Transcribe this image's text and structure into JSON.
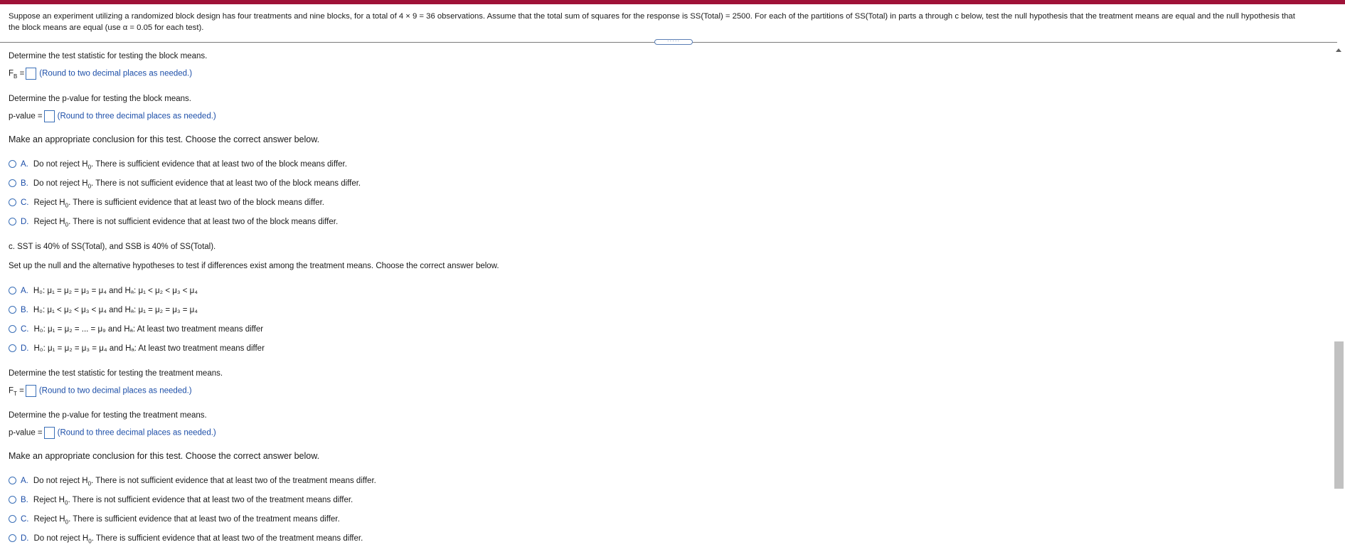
{
  "problem_text_line1": "Suppose an experiment utilizing a randomized block design has four treatments and nine blocks, for a total of 4 × 9 = 36 observations. Assume that the total sum of squares for the response is SS(Total) = 2500. For each of the partitions of SS(Total) in parts a through c below, test the null hypothesis that the treatment means are equal and the null hypothesis that",
  "problem_text_line2": "the block means are equal (use α = 0.05 for each test).",
  "splitter_grip": "·····",
  "block": {
    "stat_prompt": "Determine the test statistic for testing the block means.",
    "stat_label": "F",
    "stat_sub": "B",
    "stat_eq": " =",
    "stat_hint": "(Round to two decimal places as needed.)",
    "p_prompt": "Determine the p-value for testing the block means.",
    "p_label": "p-value =",
    "p_hint": "(Round to three decimal places as needed.)",
    "conclusion_prompt": "Make an appropriate conclusion for this test. Choose the correct answer below.",
    "choices": [
      {
        "letter": "A.",
        "pre": "Do not reject H",
        "sub": "0",
        "post": ". There is sufficient evidence that at least two of the block means differ."
      },
      {
        "letter": "B.",
        "pre": "Do not reject H",
        "sub": "0",
        "post": ". There is not sufficient evidence that at least two of the block means differ."
      },
      {
        "letter": "C.",
        "pre": "Reject H",
        "sub": "0",
        "post": ". There is sufficient evidence that at least two of the block means differ."
      },
      {
        "letter": "D.",
        "pre": "Reject H",
        "sub": "0",
        "post": ". There is not sufficient evidence that at least two of the block means differ."
      }
    ]
  },
  "part_c": {
    "header": "c. SST is 40% of SS(Total), and SSB is 40% of SS(Total).",
    "hyp_prompt": "Set up the null and the alternative hypotheses to test if differences exist among the treatment means. Choose the correct answer below.",
    "hyp_choices": [
      {
        "letter": "A.",
        "text": "H₀: μ₁ = μ₂ = μ₃ = μ₄ and Hₐ: μ₁ < μ₂ < μ₃ < μ₄"
      },
      {
        "letter": "B.",
        "text": "H₀: μ₁ < μ₂ < μ₃ < μ₄ and Hₐ: μ₁ = μ₂ = μ₃ = μ₄"
      },
      {
        "letter": "C.",
        "text": "H₀: μ₁ = μ₂ = ... = μ₉ and Hₐ: At least two treatment means differ"
      },
      {
        "letter": "D.",
        "text": "H₀: μ₁ = μ₂ = μ₃ = μ₄ and Hₐ: At least two treatment means differ"
      }
    ],
    "stat_prompt": "Determine the test statistic for testing the treatment means.",
    "stat_label": "F",
    "stat_sub": "T",
    "stat_eq": " =",
    "stat_hint": "(Round to two decimal places as needed.)",
    "p_prompt": "Determine the p-value for testing the treatment means.",
    "p_label": "p-value =",
    "p_hint": "(Round to three decimal places as needed.)",
    "conclusion_prompt": "Make an appropriate conclusion for this test. Choose the correct answer below.",
    "choices": [
      {
        "letter": "A.",
        "pre": "Do not reject H",
        "sub": "0",
        "post": ". There is not sufficient evidence that at least two of the treatment means differ."
      },
      {
        "letter": "B.",
        "pre": "Reject H",
        "sub": "0",
        "post": ". There is not sufficient evidence that at least two of the treatment means differ."
      },
      {
        "letter": "C.",
        "pre": "Reject H",
        "sub": "0",
        "post": ". There is sufficient evidence that at least two of the treatment means differ."
      },
      {
        "letter": "D.",
        "pre": "Do not reject H",
        "sub": "0",
        "post": ". There is sufficient evidence that at least two of the treatment means differ."
      }
    ]
  },
  "colors": {
    "topbar": "#9f1238",
    "accent": "#1c4ea8"
  }
}
